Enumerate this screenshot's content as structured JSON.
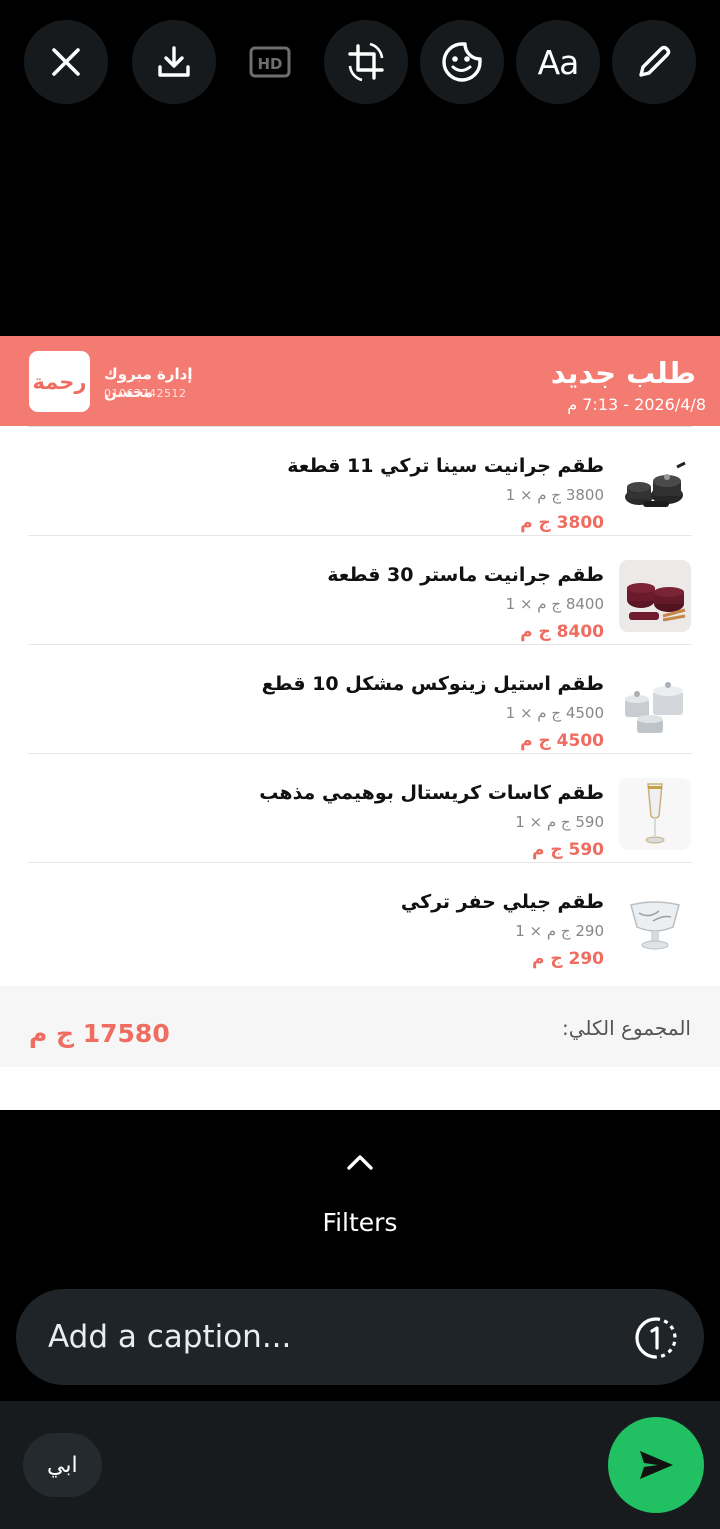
{
  "toolbar": {
    "close": "close-icon",
    "download": "download-icon",
    "hd": "HD",
    "crop": "crop-rotate-icon",
    "sticker": "sticker-icon",
    "text": "Aa",
    "draw": "pencil-icon"
  },
  "card": {
    "title": "طلب جديد",
    "date": "2026/4/8 - 7:13 م",
    "logo_text": "رحمة",
    "management_name": "إدارة مبروك محسن",
    "management_phone": "01063742512",
    "accent_color": "#f47b72",
    "items": [
      {
        "name": "طقم جرانيت سينا تركي 11 قطعة",
        "qty_line": "3800 ج م × 1",
        "total": "3800 ج م"
      },
      {
        "name": "طقم جرانيت ماستر 30 قطعة",
        "qty_line": "8400 ج م × 1",
        "total": "8400 ج م"
      },
      {
        "name": "طقم استيل زينوكس مشكل 10 قطع",
        "qty_line": "4500 ج م × 1",
        "total": "4500 ج م"
      },
      {
        "name": "طقم كاسات كريستال بوهيمي مذهب",
        "qty_line": "590 ج م × 1",
        "total": "590 ج م"
      },
      {
        "name": "طقم جيلي حفر تركي",
        "qty_line": "290 ج م × 1",
        "total": "290 ج م"
      }
    ],
    "total_label": "المجموع الكلي:",
    "total_value": "17580 ج م"
  },
  "filters": {
    "label": "Filters"
  },
  "caption": {
    "placeholder": "Add a caption...",
    "value": ""
  },
  "recipient": {
    "name": "ابي"
  },
  "send": {
    "icon": "send-icon",
    "color": "#21c063"
  }
}
